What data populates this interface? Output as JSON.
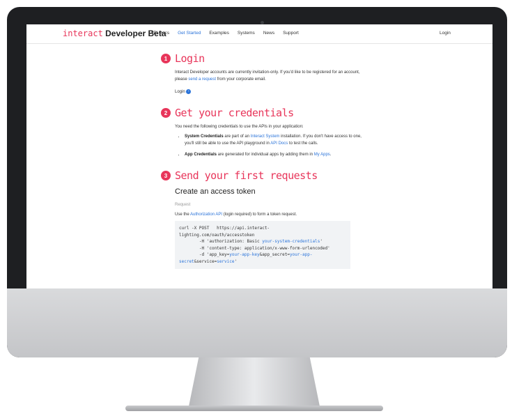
{
  "nav": {
    "logo_brand": "interact",
    "logo_dev": "Developer Beta",
    "links": [
      "API Docs",
      "Get Started",
      "Examples",
      "Systems",
      "News",
      "Support"
    ],
    "active_link": "Get Started",
    "login": "Login"
  },
  "step1": {
    "number": "1",
    "title": "Login",
    "text_a": "Interact Developer accounts are currently invitation-only. If you'd like to be registered for an account, please ",
    "link": "send a request",
    "text_b": " from your corporate email.",
    "login_link": "Login"
  },
  "step2": {
    "number": "2",
    "title": "Get your credentials",
    "intro": "You need the following credentials to use the APIs in your application:",
    "b1_bold": "System Credentials",
    "b1_text_a": " are part of an ",
    "b1_link1": "Interact System",
    "b1_text_b": " installation. If you don't have access to one, you'll still be able to use the API playground in ",
    "b1_link2": "API Docs",
    "b1_text_c": " to test the calls.",
    "b2_bold": "App Credentials",
    "b2_text": " are generated for individual apps by adding them in ",
    "b2_link": "My Apps",
    "b2_end": "."
  },
  "step3": {
    "number": "3",
    "title": "Send your first requests",
    "subheading": "Create an access token",
    "request_label": "Request",
    "use_text_a": "Use the ",
    "use_link": "Authorization API",
    "use_text_b": " (login required) to form a token request.",
    "code_l1": "curl -X POST   https://api.interact-",
    "code_l2": "lighting.com/oauth/accesstoken",
    "code_l3a": "        -H 'authorization: Basic ",
    "code_l3v": "your-system-credentials",
    "code_l3b": "'",
    "code_l4": "        -H 'content-type: application/x-www-form-urlencoded'",
    "code_l5a": "        -d 'app_key=",
    "code_l5v1": "your-app-key",
    "code_l5b": "&app_secret=",
    "code_l5v2": "your-app-",
    "code_l6v": "secret",
    "code_l6b": "&service=",
    "code_l6v2": "service",
    "code_l6c": "'"
  }
}
